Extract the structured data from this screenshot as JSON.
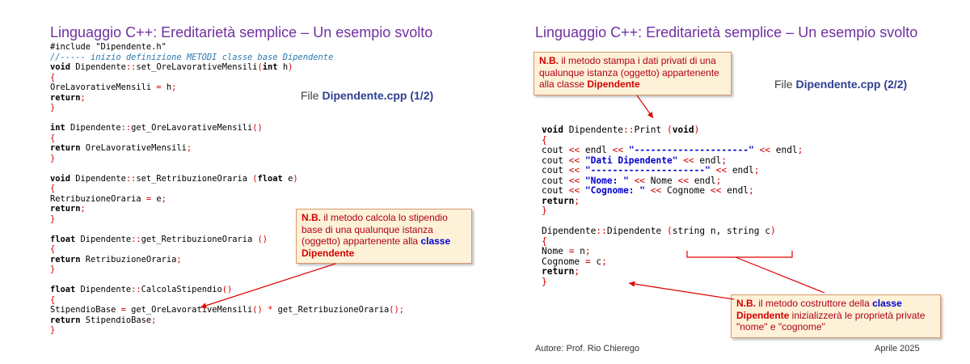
{
  "left": {
    "title": "Linguaggio C++: Ereditarietà semplice – Un esempio svolto",
    "file_prefix": "File ",
    "file_name": "Dipendente.cpp (1/2)",
    "code": [
      "#include \"Dipendente.h\"",
      "//----- inizio definizione METODI classe base Dipendente",
      "void Dipendente::set_OreLavorativeMensili(int h)",
      "{",
      "OreLavorativeMensili = h;",
      "return;",
      "}",
      "",
      "int Dipendente::get_OreLavorativeMensili()",
      "{",
      "return OreLavorativeMensili;",
      "}",
      "",
      "void Dipendente::set_RetribuzioneOraria (float e)",
      "{",
      "RetribuzioneOraria = e;",
      "return;",
      "}",
      "",
      "float Dipendente::get_RetribuzioneOraria ()",
      "{",
      "return RetribuzioneOraria;",
      "}",
      "",
      "float Dipendente::CalcolaStipendio()",
      "{",
      "StipendioBase = get_OreLavorativeMensili() * get_RetribuzioneOraria();",
      "return StipendioBase;",
      "}"
    ],
    "note": {
      "nb": "N.B.",
      "text": " il metodo calcola lo stipendio base di una qualunque istanza (oggetto) appartenente alla ",
      "kw1": "classe",
      "kw2": "Dipendente"
    }
  },
  "right": {
    "title": "Linguaggio C++: Ereditarietà semplice – Un esempio svolto",
    "file_prefix": "File ",
    "file_name": "Dipendente.cpp (2/2)",
    "code": [
      "void Dipendente::Print (void)",
      "{",
      "cout << endl << \"---------------------\" << endl;",
      "cout << \"Dati Dipendente\" << endl;",
      "cout << \"---------------------\" << endl;",
      "cout << \"Nome: \" << Nome << endl;",
      "cout << \"Cognome: \" << Cognome << endl;",
      "return;",
      "}",
      "",
      "Dipendente::Dipendente (string n, string c)",
      "{",
      "Nome = n;",
      "Cognome = c;",
      "return;",
      "}"
    ],
    "note_top": {
      "nb": "N.B.",
      "text": " il metodo stampa i dati privati di una qualunque istanza (oggetto) appartenente alla classe ",
      "kw": "Dipendente"
    },
    "note_bottom": {
      "nb": "N.B.",
      "text1": " il metodo costruttore della ",
      "kw1": "classe",
      "kw2": "Dipendente",
      "text2": " inizializzerà le proprietà private \"nome\" e \"cognome\""
    },
    "footer_author": "Autore: Prof. Rio Chierego",
    "footer_date": "Aprile 2025"
  }
}
